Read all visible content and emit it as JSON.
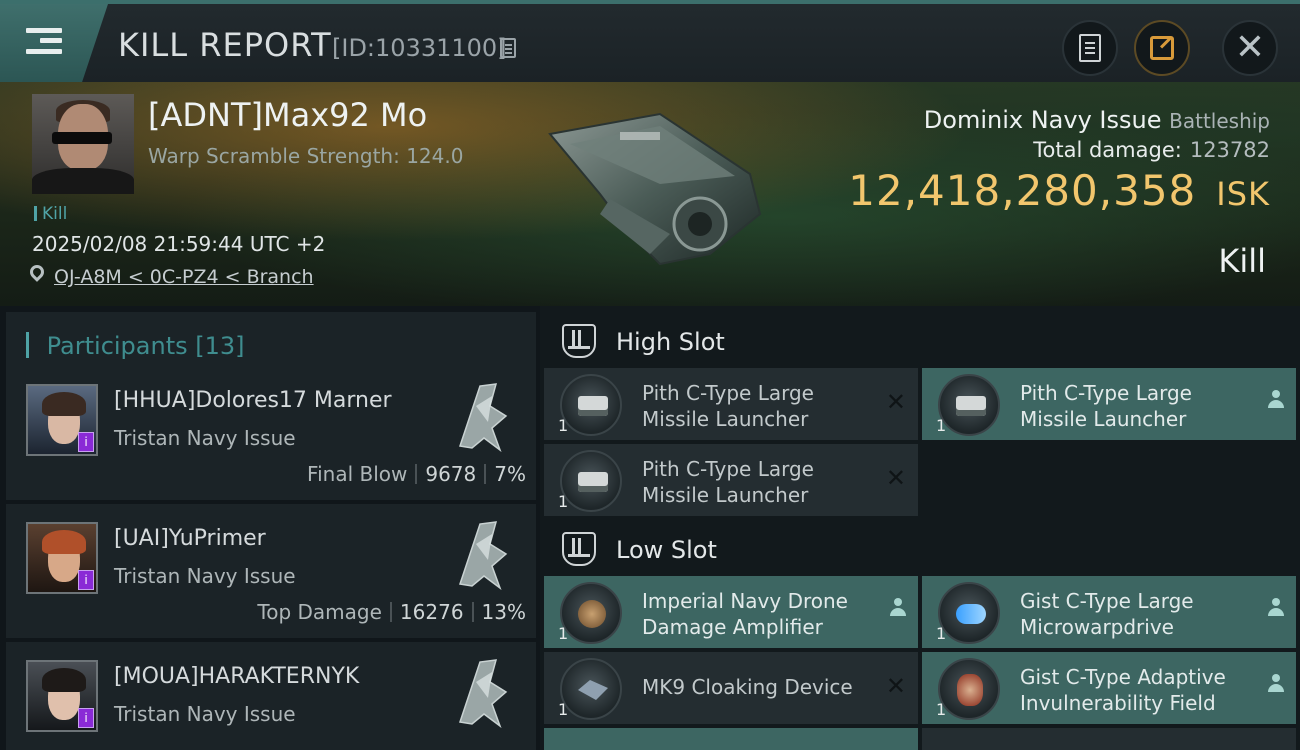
{
  "header": {
    "title": "KILL REPORT",
    "report_id": "[ID:10331100]",
    "buttons": {
      "notes_icon": "notes-icon",
      "share_icon": "share-icon",
      "close_icon": "close-icon"
    }
  },
  "victim": {
    "name": "[ADNT]Max92 Mo",
    "warp_scramble": "Warp Scramble Strength: 124.0",
    "tag": "Kill",
    "timestamp": "2025/02/08 21:59:44 UTC +2",
    "location": "OJ-A8M < 0C-PZ4 < Branch",
    "ship_name": "Dominix Navy Issue",
    "ship_class": "Battleship",
    "total_damage_label": "Total damage:",
    "total_damage": "123782",
    "isk_value": "12,418,280,358",
    "isk_unit": "ISK",
    "result": "Kill"
  },
  "participants": {
    "title": "Participants",
    "count": "[13]",
    "items": [
      {
        "name": "[HHUA]Dolores17 Marner",
        "ship": "Tristan Navy Issue",
        "role": "Final Blow",
        "damage": "9678",
        "percent": "7%"
      },
      {
        "name": "[UAI]YuPrimer",
        "ship": "Tristan Navy Issue",
        "role": "Top Damage",
        "damage": "16276",
        "percent": "13%"
      },
      {
        "name": "[MOUA]HARAKTERNYK",
        "ship": "Tristan Navy Issue",
        "role": "",
        "damage": "",
        "percent": ""
      }
    ]
  },
  "fitting": {
    "high_slot": {
      "title": "High Slot",
      "modules": [
        {
          "name": "Pith C-Type Large Missile Launcher",
          "qty": "1",
          "status": "destroyed"
        },
        {
          "name": "Pith C-Type Large Missile Launcher",
          "qty": "1",
          "status": "dropped"
        },
        {
          "name": "Pith C-Type Large Missile Launcher",
          "qty": "1",
          "status": "destroyed"
        }
      ]
    },
    "low_slot": {
      "title": "Low Slot",
      "modules": [
        {
          "name": "Imperial Navy Drone Damage Amplifier",
          "qty": "1",
          "status": "dropped"
        },
        {
          "name": "Gist C-Type Large Microwarpdrive",
          "qty": "1",
          "status": "dropped"
        },
        {
          "name": "MK9 Cloaking Device",
          "qty": "1",
          "status": "destroyed"
        },
        {
          "name": "Gist C-Type Adaptive Invulnerability Field",
          "qty": "1",
          "status": "dropped"
        }
      ]
    }
  },
  "colors": {
    "accent": "#3f8d8f",
    "isk": "#f2c66d",
    "dropped": "#3d6662",
    "destroyed": "#242d31",
    "badge": "#8a2ad6"
  }
}
